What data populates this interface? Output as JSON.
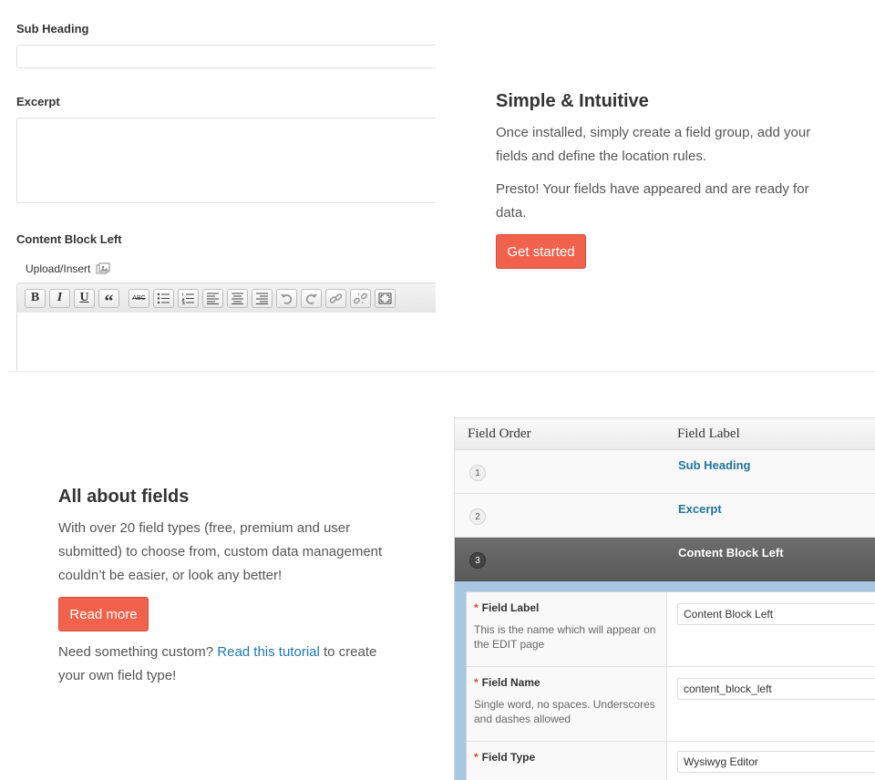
{
  "form": {
    "sub_heading_label": "Sub Heading",
    "excerpt_label": "Excerpt",
    "content_block_label": "Content Block Left",
    "upload_insert": "Upload/Insert",
    "toolbar": {
      "bold": "B",
      "italic": "I",
      "underline": "U",
      "quote": "“",
      "strike": "ABC"
    }
  },
  "simple": {
    "title": "Simple & Intuitive",
    "para1": "Once installed, simply create a field group, add your fields and define the location rules.",
    "para2": "Presto! Your fields have appeared and are ready for data.",
    "cta": "Get started"
  },
  "fields_block": {
    "title": "All about fields",
    "para": "With over 20 field types (free, premium and user submitted) to choose from, custom data management couldn’t be easier, or look any better!",
    "cta": "Read more",
    "custom_prefix": "Need something custom? ",
    "custom_link": "Read this tutorial",
    "custom_suffix": " to create your own field type!"
  },
  "table": {
    "col_order": "Field Order",
    "col_label": "Field Label",
    "rows": [
      {
        "order": "1",
        "label": "Sub Heading"
      },
      {
        "order": "2",
        "label": "Excerpt"
      },
      {
        "order": "3",
        "label": "Content Block Left"
      }
    ],
    "settings": [
      {
        "name": "Field Label",
        "desc": "This is the name which will appear on the EDIT page",
        "value": "Content Block Left"
      },
      {
        "name": "Field Name",
        "desc": "Single word, no spaces. Underscores and dashes allowed",
        "value": "content_block_left"
      },
      {
        "name": "Field Type",
        "desc": "",
        "value": "Wysiwyg Editor"
      }
    ],
    "required_mark": "*"
  },
  "colors": {
    "cta": "#f1624c",
    "link": "#21759b",
    "active_row": "#5f5f5f",
    "settings_frame": "#a8c7e3"
  },
  "icons": [
    "upload-media-icon",
    "bullet-list-icon",
    "numbered-list-icon",
    "align-left-icon",
    "align-center-icon",
    "align-right-icon",
    "undo-icon",
    "redo-icon",
    "link-icon",
    "unlink-icon",
    "fullscreen-icon"
  ]
}
